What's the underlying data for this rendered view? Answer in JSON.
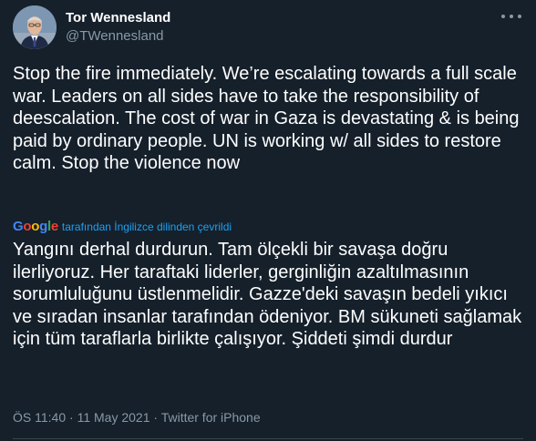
{
  "author": {
    "display_name": "Tor Wennesland",
    "handle": "@TWennesland"
  },
  "icons": {
    "more": "more-horizontal-icon",
    "avatar": "avatar-photo"
  },
  "tweet": {
    "text": "Stop the fire immediately. We’re escalating towards a full scale war. Leaders on all sides have to take the responsibility of deescalation. The cost of war in Gaza is devastating & is being paid by ordinary people. UN is working w/ all sides to restore calm. Stop the violence now",
    "translation_label": "tarafından İngilizce dilinden çevrildi",
    "translation_provider": "Google",
    "translation_text": "Yangını derhal durdurun. Tam ölçekli bir savaşa doğru ilerliyoruz. Her taraftaki liderler, gerginliğin azaltılmasının sorumluluğunu üstlenmelidir. Gazze'deki savaşın bedeli yıkıcı ve sıradan insanlar tarafından ödeniyor. BM sükuneti sağlamak için tüm taraflarla birlikte çalışıyor. Şiddeti şimdi durdur"
  },
  "meta": {
    "time": "ÖS 11:40",
    "separator": " · ",
    "date": "11 May 2021",
    "source": "Twitter for iPhone"
  },
  "colors": {
    "background": "#15202b",
    "text": "#ffffff",
    "secondary": "#8899a6",
    "link": "#1da1f2"
  }
}
